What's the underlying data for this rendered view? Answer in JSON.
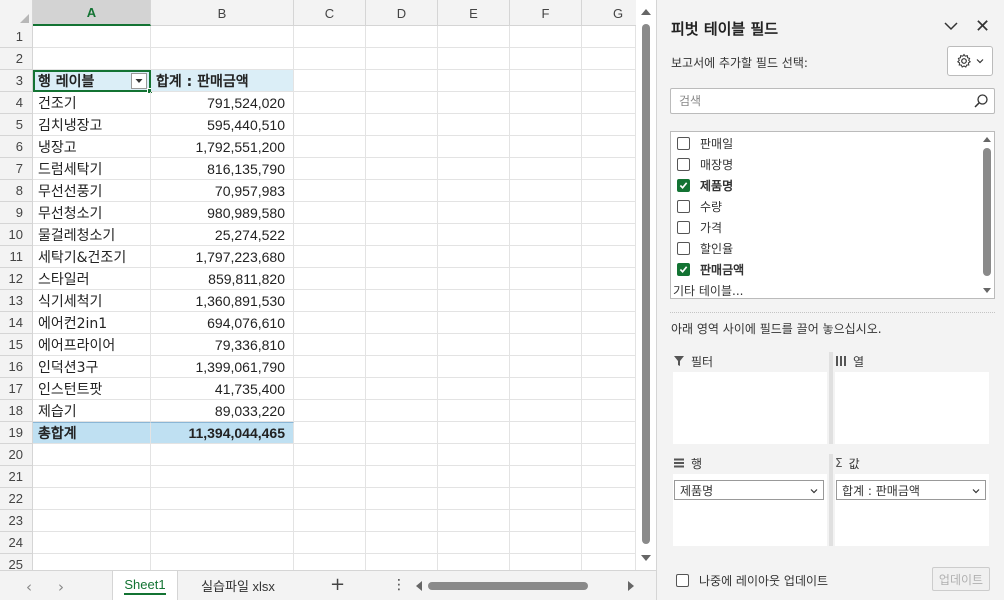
{
  "sheet": {
    "columns": [
      "A",
      "B",
      "C",
      "D",
      "E",
      "F",
      "G"
    ],
    "active_column": "A",
    "row_numbers": [
      "1",
      "2",
      "3",
      "4",
      "5",
      "6",
      "7",
      "8",
      "9",
      "10",
      "11",
      "12",
      "13",
      "14",
      "15",
      "16",
      "17",
      "18",
      "19",
      "20",
      "21",
      "22",
      "23",
      "24",
      "25"
    ],
    "pivot_header": {
      "row_label": "행 레이블",
      "value_label": "합계 : 판매금액"
    },
    "pivot_rows": [
      {
        "label": "건조기",
        "value": "791,524,020"
      },
      {
        "label": "김치냉장고",
        "value": "595,440,510"
      },
      {
        "label": "냉장고",
        "value": "1,792,551,200"
      },
      {
        "label": "드럼세탁기",
        "value": "816,135,790"
      },
      {
        "label": "무선선풍기",
        "value": "70,957,983"
      },
      {
        "label": "무선청소기",
        "value": "980,989,580"
      },
      {
        "label": "물걸레청소기",
        "value": "25,274,522"
      },
      {
        "label": "세탁기&건조기",
        "value": "1,797,223,680"
      },
      {
        "label": "스타일러",
        "value": "859,811,820"
      },
      {
        "label": "식기세척기",
        "value": "1,360,891,530"
      },
      {
        "label": "에어컨2in1",
        "value": "694,076,610"
      },
      {
        "label": "에어프라이어",
        "value": "79,336,810"
      },
      {
        "label": "인덕션3구",
        "value": "1,399,061,790"
      },
      {
        "label": "인스턴트팟",
        "value": "41,735,400"
      },
      {
        "label": "제습기",
        "value": "89,033,220"
      }
    ],
    "grand_total": {
      "label": "총합계",
      "value": "11,394,044,465"
    },
    "tabs": [
      "Sheet1",
      "실습파일 xlsx"
    ],
    "active_tab": "Sheet1",
    "tab_nav": {
      "prev": "‹",
      "next": "›",
      "add": "+",
      "more": "⋮"
    }
  },
  "pivot_pane": {
    "title": "피벗 테이블 필드",
    "close": "✕",
    "subtitle": "보고서에 추가할 필드 선택:",
    "search_placeholder": "검색",
    "fields": [
      {
        "label": "판매일",
        "checked": false
      },
      {
        "label": "매장명",
        "checked": false
      },
      {
        "label": "제품명",
        "checked": true
      },
      {
        "label": "수량",
        "checked": false
      },
      {
        "label": "가격",
        "checked": false
      },
      {
        "label": "할인율",
        "checked": false
      },
      {
        "label": "판매금액",
        "checked": true
      }
    ],
    "more_tables": "기타 테이블...",
    "drag_hint": "아래 영역 사이에 필드를 끌어 놓으십시오.",
    "areas": {
      "filter": {
        "label": "필터"
      },
      "columns": {
        "label": "열"
      },
      "rows": {
        "label": "행",
        "item": "제품명"
      },
      "values": {
        "label": "값",
        "sigma": "Σ",
        "item": "합계 : 판매금액"
      }
    },
    "defer_label": "나중에 레이아웃 업데이트",
    "update_button": "업데이트"
  },
  "colors": {
    "accent": "#137333",
    "header_blue": "#dbeef7",
    "total_blue": "#bfe0f2"
  }
}
